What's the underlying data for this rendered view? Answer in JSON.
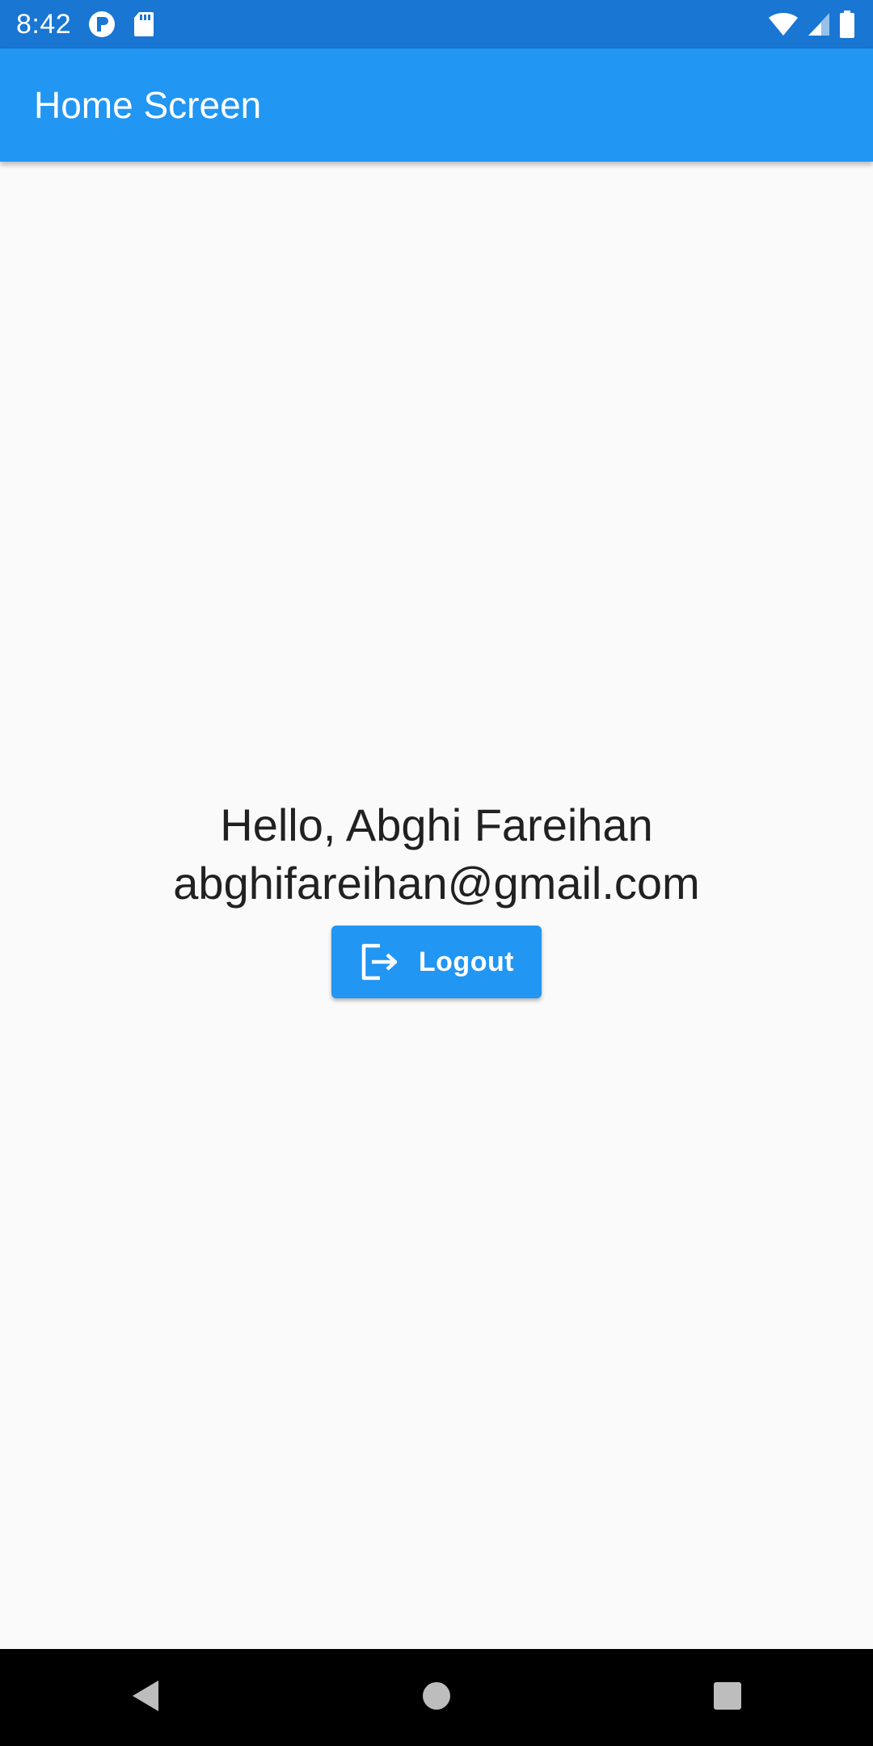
{
  "status_bar": {
    "time": "8:42",
    "left_icons": [
      "notification-app-icon",
      "sd-card-icon"
    ],
    "right_icons": [
      "wifi-icon",
      "cell-signal-icon",
      "battery-icon"
    ]
  },
  "app_bar": {
    "title": "Home Screen"
  },
  "main": {
    "greeting": "Hello, Abghi Fareihan",
    "email": "abghifareihan@gmail.com",
    "logout_button": {
      "label": "Logout",
      "icon": "logout-icon"
    }
  },
  "nav_bar": {
    "buttons": [
      "back-icon",
      "home-icon",
      "recents-icon"
    ]
  },
  "colors": {
    "primary": "#2196f3",
    "status_bar": "#1976d2",
    "background": "#fafafa",
    "text": "#212121",
    "nav_bar": "#000000"
  }
}
